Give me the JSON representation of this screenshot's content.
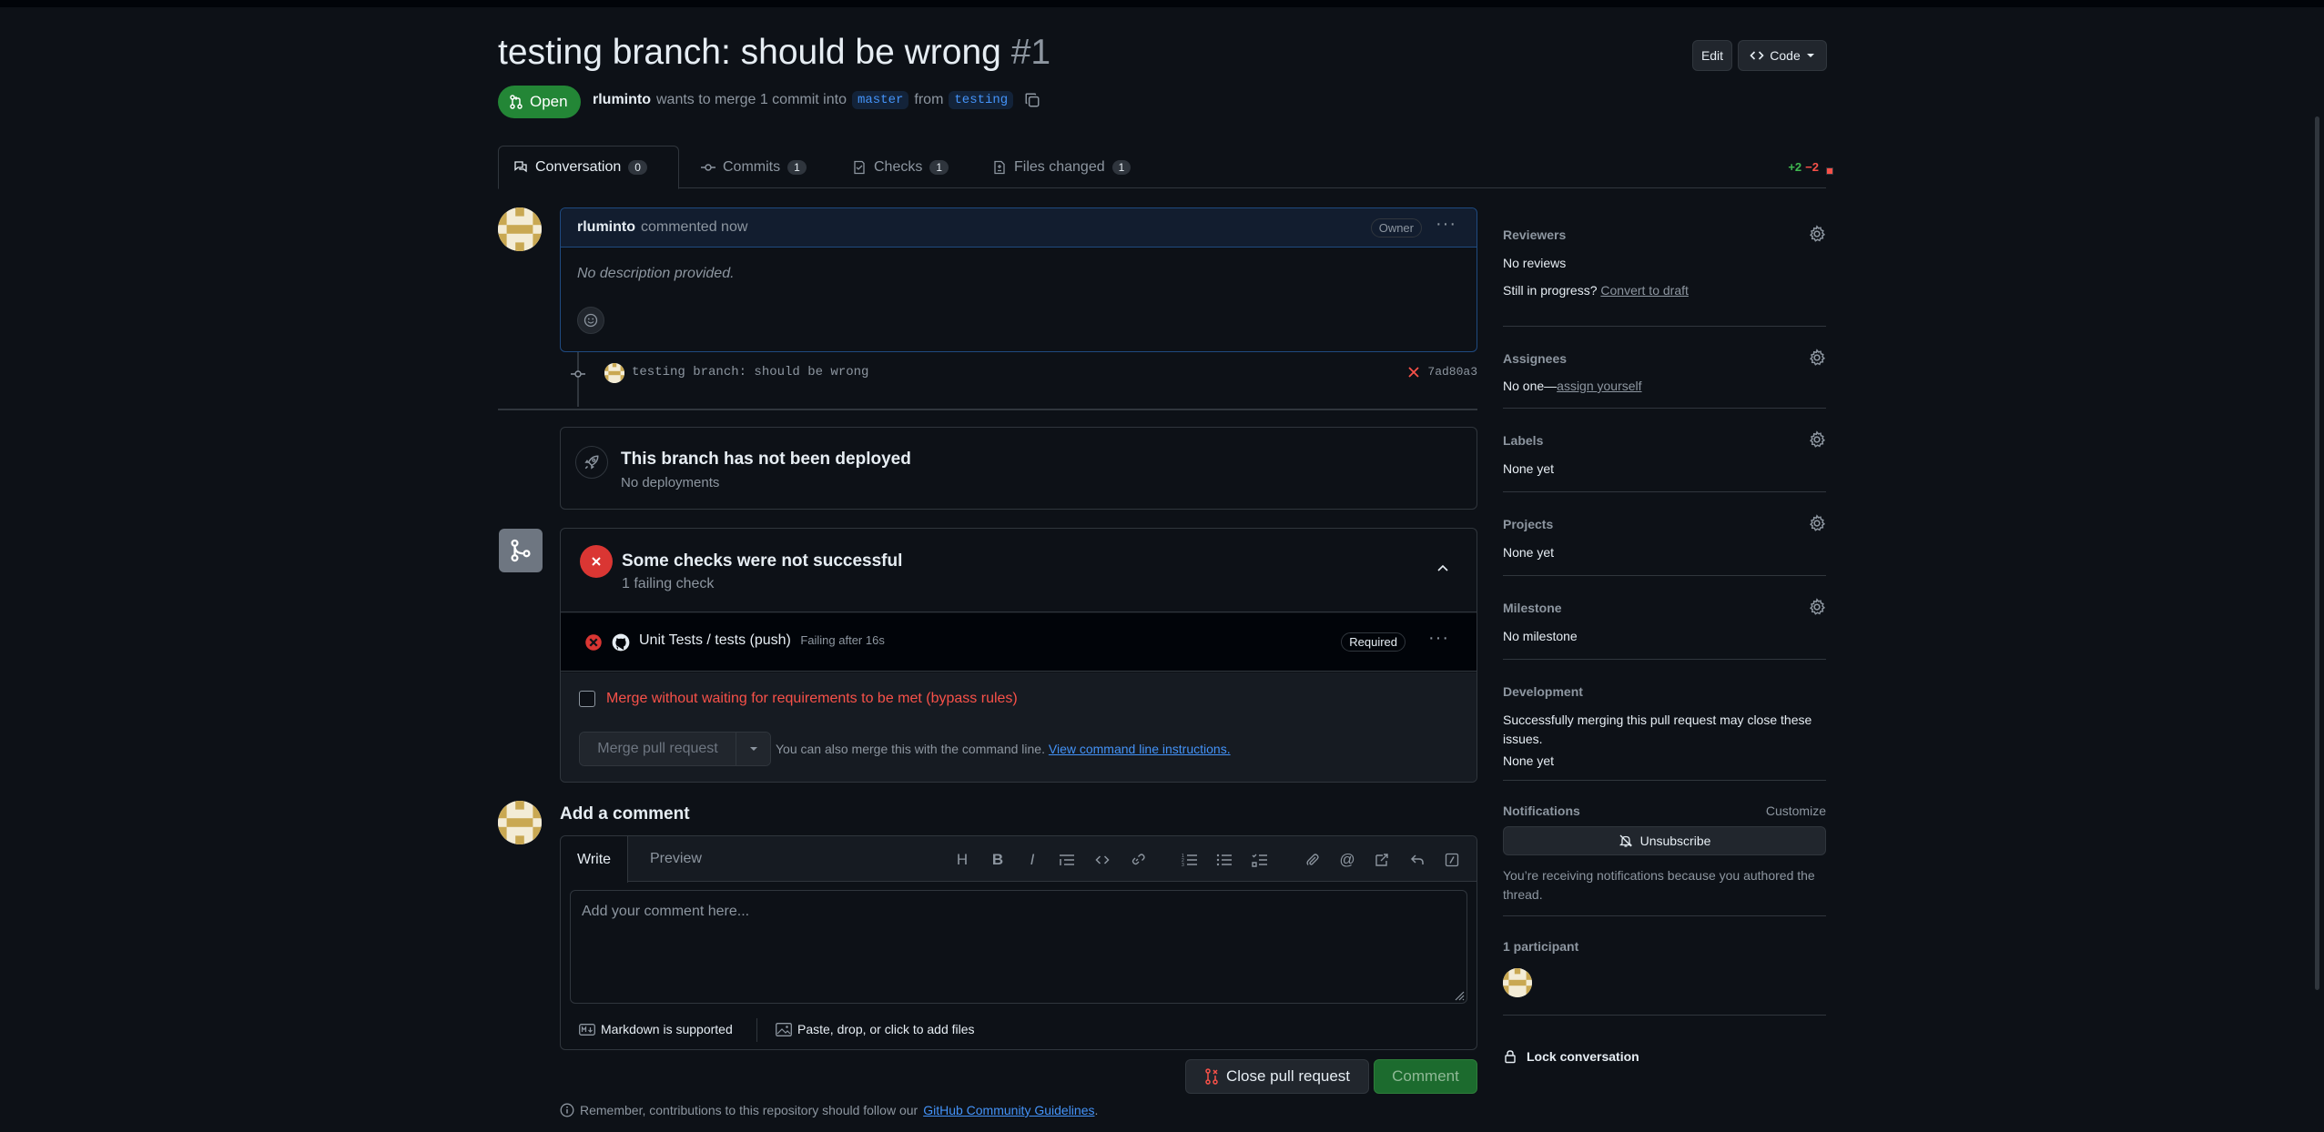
{
  "header": {
    "title": "testing branch: should be wrong",
    "number": "#1",
    "state_label": "Open",
    "author": "rluminto",
    "merge_text": "wants to merge 1 commit into",
    "base_branch": "master",
    "from_text": "from",
    "head_branch": "testing",
    "edit_label": "Edit",
    "code_label": "Code"
  },
  "tabs": [
    {
      "label": "Conversation",
      "count": "0",
      "icon": "conversation-icon"
    },
    {
      "label": "Commits",
      "count": "1",
      "icon": "commit-icon"
    },
    {
      "label": "Checks",
      "count": "1",
      "icon": "checklist-icon"
    },
    {
      "label": "Files changed",
      "count": "1",
      "icon": "file-diff-icon"
    }
  ],
  "diffstat": {
    "additions": "+2",
    "deletions": "−2",
    "colors": [
      "#3fb950",
      "#3fb950",
      "#f85149",
      "#f85149",
      "#f85149"
    ]
  },
  "comment": {
    "author": "rluminto",
    "action": "commented now",
    "role": "Owner",
    "body": "No description provided."
  },
  "commit": {
    "message": "testing branch: should be wrong",
    "sha": "7ad80a3",
    "status": "failure"
  },
  "deploy": {
    "title": "This branch has not been deployed",
    "subtitle": "No deployments"
  },
  "checks": {
    "title": "Some checks were not successful",
    "subtitle": "1 failing check",
    "item_name": "Unit Tests / tests (push)",
    "item_status": "Failing after 16s",
    "item_badge": "Required",
    "bypass_label": "Merge without waiting for requirements to be met (bypass rules)",
    "merge_button": "Merge pull request",
    "cli_text": "You can also merge this with the command line.",
    "cli_link": "View command line instructions."
  },
  "composer": {
    "title": "Add a comment",
    "tab_write": "Write",
    "tab_preview": "Preview",
    "placeholder": "Add your comment here...",
    "markdown_label": "Markdown is supported",
    "files_label": "Paste, drop, or click to add files",
    "close_button": "Close pull request",
    "comment_button": "Comment",
    "guidelines_text": "Remember, contributions to this repository should follow our",
    "guidelines_link": "GitHub Community Guidelines",
    "guidelines_end": "."
  },
  "sidebar": {
    "reviewers": {
      "title": "Reviewers",
      "value": "No reviews",
      "progress_text": "Still in progress?",
      "draft_link": "Convert to draft"
    },
    "assignees": {
      "title": "Assignees",
      "value": "No one—",
      "link": "assign yourself"
    },
    "labels": {
      "title": "Labels",
      "value": "None yet"
    },
    "projects": {
      "title": "Projects",
      "value": "None yet"
    },
    "milestone": {
      "title": "Milestone",
      "value": "No milestone"
    },
    "development": {
      "title": "Development",
      "desc": "Successfully merging this pull request may close these issues.",
      "value": "None yet"
    },
    "notifications": {
      "title": "Notifications",
      "customize": "Customize",
      "button": "Unsubscribe",
      "reason": "You’re receiving notifications because you authored the thread."
    },
    "participants": {
      "title": "1 participant"
    },
    "lock": {
      "label": "Lock conversation"
    }
  },
  "colors": {
    "accent": "#4493f8",
    "success": "#238636",
    "danger": "#da3633",
    "bg": "#0d1117"
  }
}
